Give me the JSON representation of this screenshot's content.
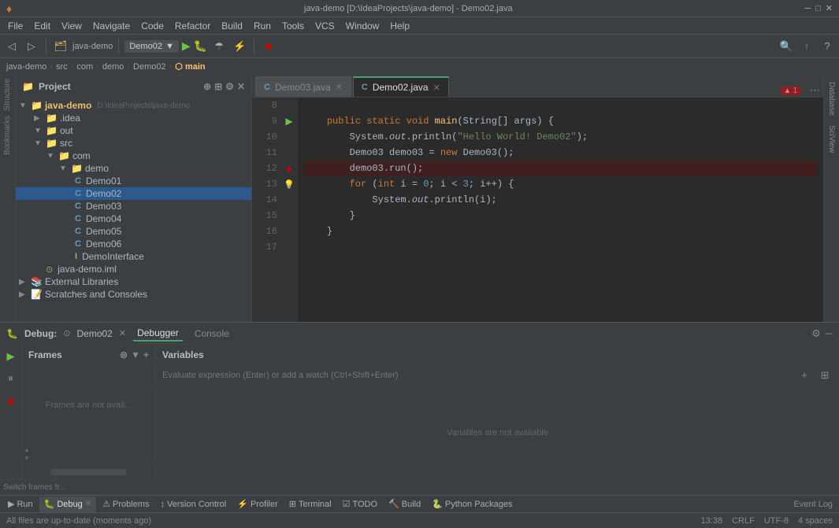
{
  "titleBar": {
    "title": "java-demo [D:\\IdeaProjects\\java-demo] - Demo02.java",
    "appIcon": "♦"
  },
  "menuBar": {
    "items": [
      "File",
      "Edit",
      "View",
      "Navigate",
      "Code",
      "Refactor",
      "Build",
      "Run",
      "Tools",
      "VCS",
      "Window",
      "Help"
    ]
  },
  "toolbar": {
    "projectName": "java-demo",
    "runConfig": "Demo02",
    "searchLabel": "🔍"
  },
  "breadcrumb": {
    "parts": [
      "java-demo",
      "src",
      "com",
      "demo",
      "Demo02",
      "main"
    ]
  },
  "projectPanel": {
    "title": "Project",
    "rootName": "java-demo",
    "rootPath": "D:\\IdeaProjects\\java-demo",
    "items": [
      {
        "indent": 1,
        "type": "folder",
        "name": ".idea",
        "expanded": false
      },
      {
        "indent": 1,
        "type": "folder-open",
        "name": "out",
        "expanded": true
      },
      {
        "indent": 1,
        "type": "folder-open",
        "name": "src",
        "expanded": true
      },
      {
        "indent": 2,
        "type": "folder-open",
        "name": "com",
        "expanded": true
      },
      {
        "indent": 3,
        "type": "folder-open",
        "name": "demo",
        "expanded": true
      },
      {
        "indent": 4,
        "type": "class",
        "name": "Demo01"
      },
      {
        "indent": 4,
        "type": "class",
        "name": "Demo02",
        "selected": true
      },
      {
        "indent": 4,
        "type": "class",
        "name": "Demo03"
      },
      {
        "indent": 4,
        "type": "class",
        "name": "Demo04"
      },
      {
        "indent": 4,
        "type": "class",
        "name": "Demo05"
      },
      {
        "indent": 4,
        "type": "class",
        "name": "Demo06"
      },
      {
        "indent": 4,
        "type": "interface",
        "name": "DemoInterface"
      },
      {
        "indent": 1,
        "type": "iml",
        "name": "java-demo.iml"
      },
      {
        "indent": 0,
        "type": "folder",
        "name": "External Libraries",
        "expanded": false
      },
      {
        "indent": 0,
        "type": "folder",
        "name": "Scratches and Consoles",
        "expanded": false
      }
    ]
  },
  "editor": {
    "tabs": [
      {
        "name": "Demo03.java",
        "active": false,
        "icon": "C"
      },
      {
        "name": "Demo02.java",
        "active": true,
        "icon": "C"
      }
    ],
    "lines": [
      {
        "num": 8,
        "gutter": "",
        "code": ""
      },
      {
        "num": 9,
        "gutter": "run",
        "code": "    <kw>public</kw> <kw>static</kw> <kw>void</kw> <fn>main</fn>(String[] args) {"
      },
      {
        "num": 10,
        "gutter": "",
        "code": "        System.<italic>out</italic>.println(\"Hello World! Demo02\");"
      },
      {
        "num": 11,
        "gutter": "",
        "code": "        Demo03 demo03 = <kw>new</kw> Demo03();"
      },
      {
        "num": 12,
        "gutter": "bp",
        "code": "        demo03.run();",
        "highlight": true
      },
      {
        "num": 13,
        "gutter": "bulb",
        "code": "        <kw>for</kw> (<kw>int</kw> i = 0; i < 3; i++) {"
      },
      {
        "num": 14,
        "gutter": "",
        "code": "            System.<italic>out</italic>.println(i);"
      },
      {
        "num": 15,
        "gutter": "",
        "code": "        }"
      },
      {
        "num": 16,
        "gutter": "",
        "code": "    }"
      },
      {
        "num": 17,
        "gutter": "",
        "code": ""
      }
    ],
    "errorBadge": "▲ 1"
  },
  "debugPanel": {
    "title": "Debug:",
    "tabName": "Demo02",
    "tabs": [
      "Debugger",
      "Console"
    ],
    "activeTab": "Debugger",
    "framesLabel": "Frames",
    "variablesLabel": "Variables",
    "framesEmpty": "Frames are not avail...",
    "variablesEmpty": "Variables are not available",
    "varInputPlaceholder": "Evaluate expression (Enter) or add a watch (Ctrl+Shift+Enter)",
    "switchFrames": "Switch frames fr..."
  },
  "bottomTabs": [
    {
      "icon": "▶",
      "label": "Run",
      "active": false
    },
    {
      "icon": "🐛",
      "label": "Debug",
      "active": true
    },
    {
      "icon": "⚠",
      "label": "Problems",
      "active": false
    },
    {
      "icon": "↕",
      "label": "Version Control",
      "active": false
    },
    {
      "icon": "⚡",
      "label": "Profiler",
      "active": false
    },
    {
      "icon": "⊞",
      "label": "Terminal",
      "active": false
    },
    {
      "icon": "☑",
      "label": "TODO",
      "active": false
    },
    {
      "icon": "🔨",
      "label": "Build",
      "active": false
    },
    {
      "icon": "🐍",
      "label": "Python Packages",
      "active": false
    }
  ],
  "bottomRight": {
    "eventLog": "Event Log"
  },
  "statusBar": {
    "message": "All files are up-to-date (moments ago)",
    "position": "13:38",
    "encoding": "CRLF",
    "charset": "UTF-8",
    "indent": "4 spaces"
  },
  "rightSidebar": {
    "tabs": [
      "Database",
      "SciView"
    ]
  }
}
